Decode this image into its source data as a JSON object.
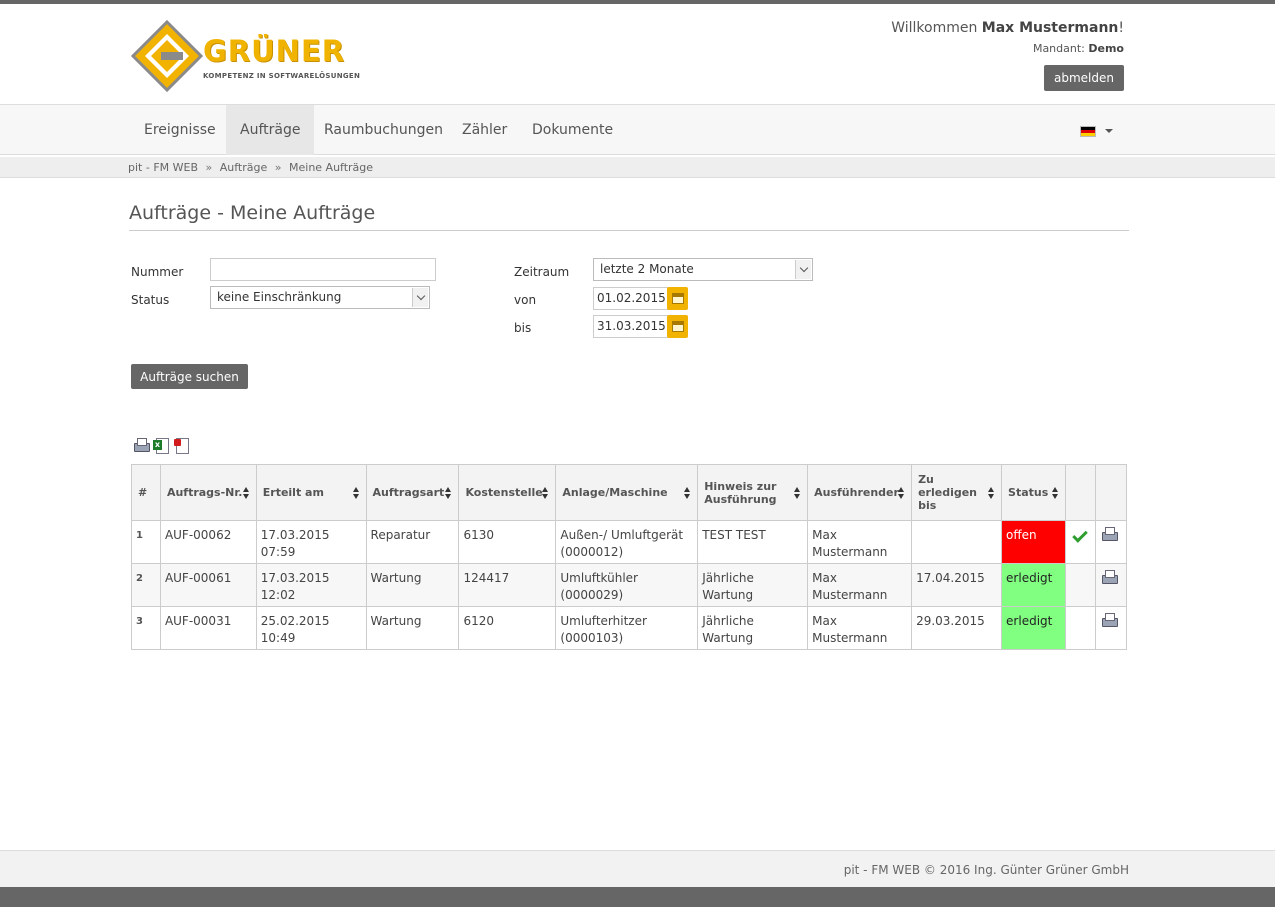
{
  "header": {
    "logo_title": "GRÜNER",
    "logo_subtitle": "KOMPETENZ IN SOFTWARELÖSUNGEN",
    "welcome_prefix": "Willkommen ",
    "user_name": "Max Mustermann",
    "welcome_suffix": "!",
    "mandant_label": "Mandant: ",
    "mandant_value": "Demo",
    "logout_label": "abmelden"
  },
  "nav": {
    "items": [
      {
        "label": "Ereignisse"
      },
      {
        "label": "Aufträge",
        "active": true
      },
      {
        "label": "Raumbuchungen"
      },
      {
        "label": "Zähler"
      },
      {
        "label": "Dokumente"
      }
    ],
    "language_icon": "german-flag-icon"
  },
  "breadcrumb": {
    "items": [
      "pit - FM WEB",
      "Aufträge",
      "Meine Aufträge"
    ],
    "separator": "»"
  },
  "page": {
    "title": "Aufträge - Meine Aufträge"
  },
  "filters": {
    "nummer_label": "Nummer",
    "nummer_value": "",
    "status_label": "Status",
    "status_value": "keine Einschränkung",
    "zeitraum_label": "Zeitraum",
    "zeitraum_value": "letzte 2 Monate",
    "von_label": "von",
    "von_value": "01.02.2015",
    "bis_label": "bis",
    "bis_value": "31.03.2015",
    "search_label": "Aufträge suchen"
  },
  "colors": {
    "accent_yellow": "#f2b300",
    "status_offen": "#ff0000",
    "status_erledigt": "#80ff80",
    "button_gray": "#666666"
  },
  "table": {
    "columns": [
      "#",
      "Auftrags-Nr.",
      "Erteilt am",
      "Auftragsart",
      "Kostenstelle",
      "Anlage/Maschine",
      "Hinweis zur Ausführung",
      "Ausführender",
      "Zu erledigen bis",
      "Status"
    ],
    "rows": [
      {
        "num": "1",
        "nr": "AUF-00062",
        "erteilt": "17.03.2015 07:59",
        "art": "Reparatur",
        "kst": "6130",
        "anlage": "Außen-/ Umluftgerät (0000012)",
        "hinweis": "TEST TEST",
        "ausfuehrender": "Max Mustermann",
        "bis": "",
        "status": "offen",
        "has_check": true
      },
      {
        "num": "2",
        "nr": "AUF-00061",
        "erteilt": "17.03.2015 12:02",
        "art": "Wartung",
        "kst": "124417",
        "anlage": "Umluftkühler (0000029)",
        "hinweis": "Jährliche Wartung",
        "ausfuehrender": "Max Mustermann",
        "bis": "17.04.2015",
        "status": "erledigt",
        "has_check": false
      },
      {
        "num": "3",
        "nr": "AUF-00031",
        "erteilt": "25.02.2015 10:49",
        "art": "Wartung",
        "kst": "6120",
        "anlage": "Umlufterhitzer (0000103)",
        "hinweis": "Jährliche Wartung",
        "ausfuehrender": "Max Mustermann",
        "bis": "29.03.2015",
        "status": "erledigt",
        "has_check": false
      }
    ]
  },
  "footer": {
    "text": "pit - FM WEB © 2016 Ing. Günter Grüner GmbH"
  }
}
